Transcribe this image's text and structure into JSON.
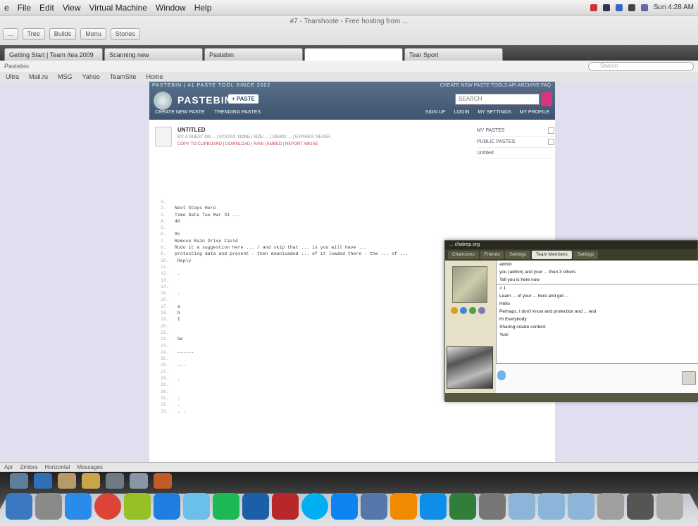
{
  "menubar": {
    "items": [
      "e",
      "File",
      "Edit",
      "View",
      "Virtual Machine",
      "Window",
      "Help"
    ],
    "clock": "Sun 4:28 AM"
  },
  "browser": {
    "window_title": "#7 - Tearshoote - Free hosting from ...",
    "toolbar": [
      "...",
      "Tree",
      "Builds",
      "Menu",
      "Stories"
    ],
    "tabs": [
      "Getting Start | Team /tea 2009 ",
      "Scanning new ",
      "Pastebin",
      "",
      "Tear Sport"
    ],
    "active_tab": 3,
    "address": "Pastebin",
    "search_placeholder": "Search",
    "bookmarks": [
      "Ultra",
      "Mail.ru",
      "MSG",
      "Yahoo",
      "TeamSite",
      "Home"
    ]
  },
  "pastebin": {
    "topline": "PASTEBIN | #1 PASTE TOOL SINCE 2002",
    "toplinks": "CREATE NEW PASTE   TOOLS   API   ARCHIVE   FAQ",
    "brand": "PASTEBIN",
    "new_paste_label": "+ PASTE",
    "search_value": "SEARCH",
    "subnav": [
      "CREATE NEW PASTE",
      "TRENDING PASTES"
    ],
    "rightnav": [
      "SIGN UP",
      "LOGIN",
      "MY SETTINGS",
      "MY PROFILE"
    ],
    "paste_title": "UNTITLED",
    "paste_meta": "BY: A GUEST ON ... | SYNTAX: NONE | SIZE: ... | VIEWS: ... | EXPIRES: NEVER",
    "paste_actions": "COPY TO CLIPBOARD | DOWNLOAD | RAW | EMBED | REPORT ABUSE",
    "sidebar_rows": [
      "MY PASTES",
      "PUBLIC PASTES",
      "Untitled"
    ],
    "code_lines": [
      "",
      "Next Steps Here",
      "Time      Date    Tue Mar 31 ...",
      "40",
      "",
      "8c",
      "Remove Rain Drive Field",
      "Rodo it a suggestion here ... / and skip that ... is you will have ...",
      "protecting data and present - then downloaded ... of it loaded there - the ... of ...",
      "  Reply",
      "",
      "  .",
      "",
      "",
      "  .",
      "",
      "  a",
      "  b",
      "  I",
      "",
      "",
      "  Ge",
      "",
      "  ------",
      "",
      "  ---",
      "",
      "  .",
      "",
      "",
      "      .",
      "  .",
      "  . ."
    ]
  },
  "chat": {
    "title": "... chatrep.org",
    "tabs": [
      "Chatrooms",
      "Friends",
      "Settings",
      "Team Members",
      "Settings"
    ],
    "active_tab": 3,
    "messages": [
      "admin",
      "you (admin) and your ... then 3 others",
      "Tell you is here now",
      "> 1",
      "Learn ... of your ... here and get ...",
      "Hello",
      "Perhaps, I don't know and protection and ... test",
      "Hi Everybody",
      "Sharing create content",
      "Yuni"
    ],
    "input_value": ""
  },
  "statusbar": {
    "items": [
      "Apr",
      "Zimbra",
      "Horizontal",
      "Messages"
    ]
  },
  "dock": {
    "apps": [
      "finder-icon",
      "system-preferences-icon",
      "app-store-icon",
      "chrome-icon",
      "android-icon",
      "ios-icon",
      "itunes-icon",
      "spotify-icon",
      "virtualbox-icon",
      "filezilla-icon",
      "skype-icon",
      "dropbox-icon",
      "xmarks-icon",
      "vlc-icon",
      "teamviewer-icon",
      "money-icon",
      "disk-icon",
      "folder-1-icon",
      "folder-2-icon",
      "folder-3-icon",
      "music-icon",
      "printer-icon",
      "trash-icon"
    ],
    "colors": [
      "#3b78c2",
      "#8a8a8a",
      "#2a8cea",
      "#db4437",
      "#97c024",
      "#1f7fe0",
      "#6ac0ea",
      "#1db954",
      "#1b5fa8",
      "#b8282a",
      "#00aff0",
      "#0d84f0",
      "#5577aa",
      "#f08a00",
      "#0e8ee9",
      "#2f7f3a",
      "#777777",
      "#8db4d9",
      "#8db4d9",
      "#8db4d9",
      "#9f9f9f",
      "#555555",
      "#aaaaaa"
    ]
  }
}
